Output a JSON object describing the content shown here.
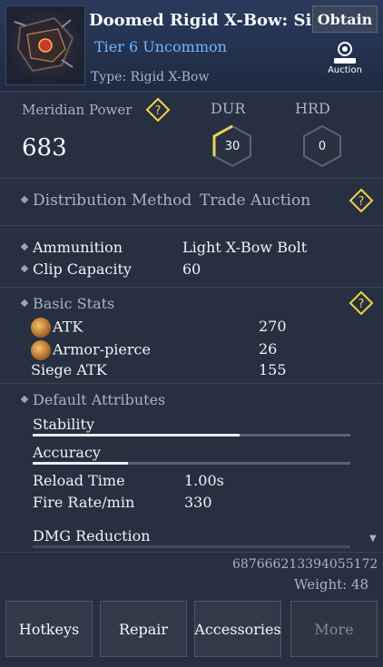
{
  "header": {
    "title": "Doomed Rigid X-Bow: Siege",
    "tier": "Tier 6 Uncommon",
    "type": "Type: Rigid X-Bow",
    "obtain_label": "Obtain",
    "auction_label": "Auction"
  },
  "summary": {
    "meridian_power_label": "Meridian Power",
    "meridian_power_value": "683",
    "dur_label": "DUR",
    "dur_value": "30",
    "hrd_label": "HRD",
    "hrd_value": "0"
  },
  "distribution": {
    "label": "Distribution Method",
    "value": "Trade Auction"
  },
  "weapon": {
    "ammunition_label": "Ammunition",
    "ammunition_value": "Light X-Bow Bolt",
    "clip_label": "Clip Capacity",
    "clip_value": "60"
  },
  "basic_stats": {
    "header": "Basic Stats",
    "items": [
      {
        "label": "ATK",
        "value": "270"
      },
      {
        "label": "Armor-pierce",
        "value": "26"
      },
      {
        "label": "Siege ATK",
        "value": "155"
      }
    ]
  },
  "default_attributes": {
    "header": "Default Attributes",
    "stability_label": "Stability",
    "stability_level": 0.65,
    "accuracy_label": "Accuracy",
    "accuracy_level": 0.3,
    "reload_label": "Reload Time",
    "reload_value": "1.00s",
    "fire_rate_label": "Fire Rate/min",
    "fire_rate_value": "330",
    "dmg_reduction_label": "DMG Reduction"
  },
  "footer": {
    "item_id": "687666213394055172",
    "weight": "Weight: 48"
  },
  "buttons": {
    "hotkeys": "Hotkeys",
    "repair": "Repair",
    "accessories": "Accessories",
    "more": "More"
  },
  "colors": {
    "tier": "#6fb6ff",
    "help_icon": "#f0d24a",
    "dur_arc": "#e8d25a"
  }
}
